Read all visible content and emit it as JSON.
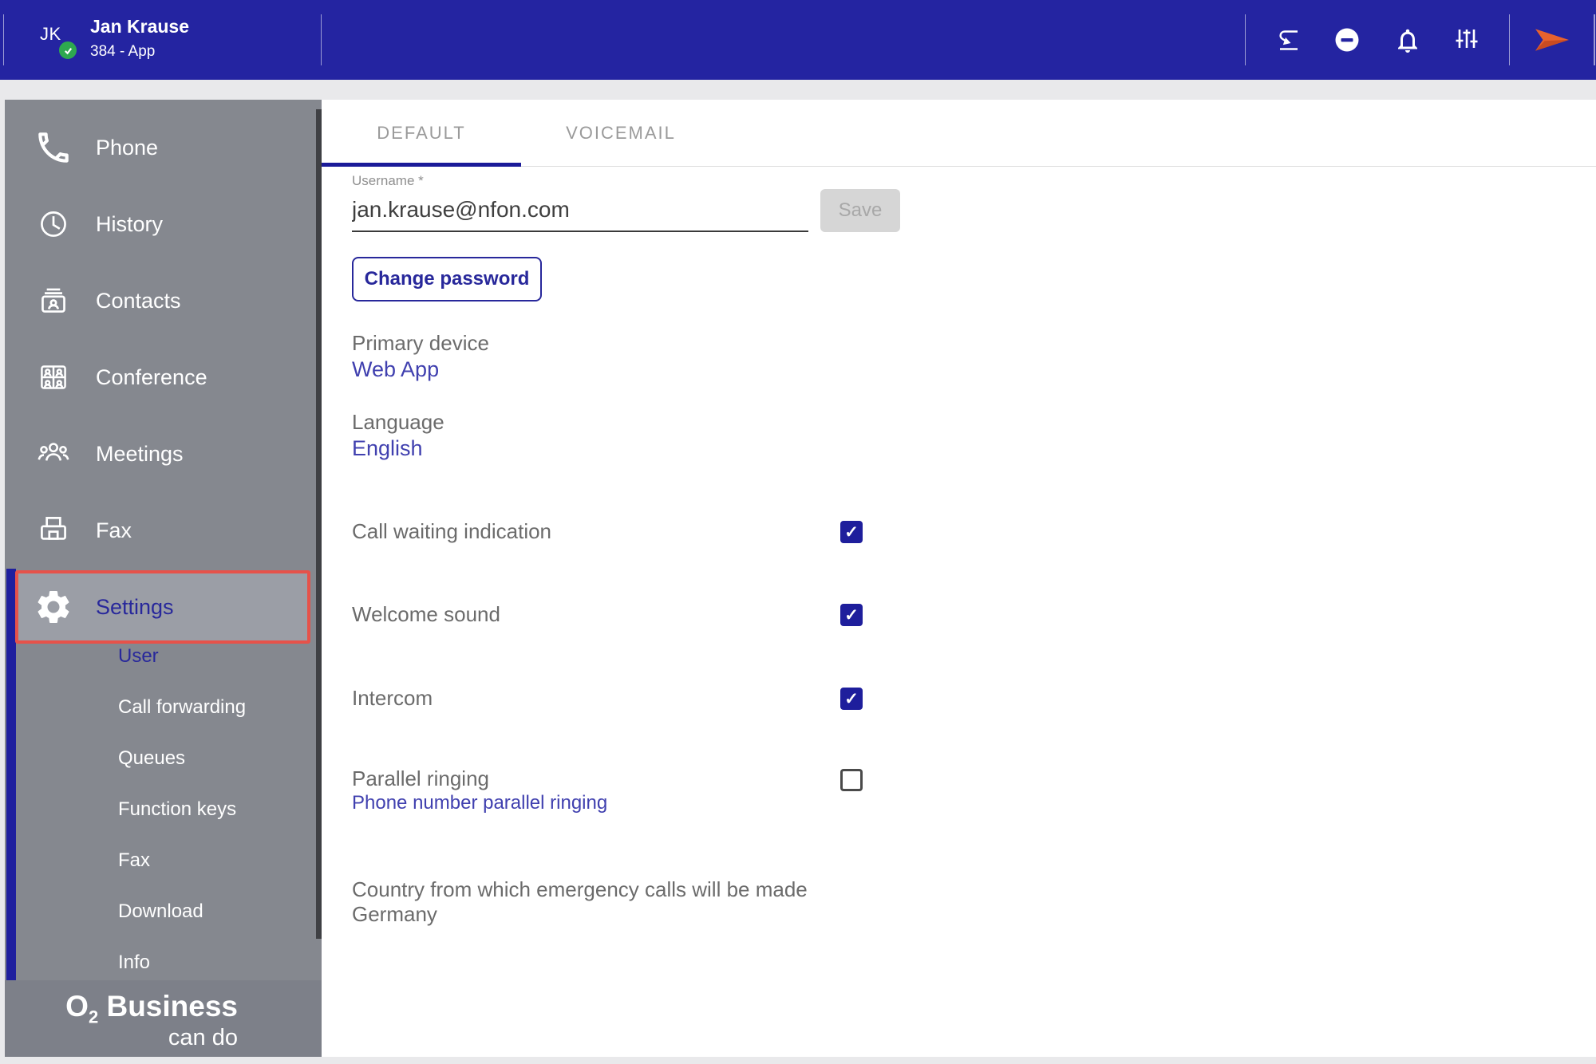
{
  "topbar": {
    "avatar_initials": "JK",
    "status": "online",
    "user_name": "Jan Krause",
    "user_subtitle": "384 - App",
    "icons": [
      "call-pull-icon",
      "dnd-status-icon",
      "notifications-icon",
      "tune-icon",
      "brand-arrow-icon"
    ]
  },
  "sidebar": {
    "items": [
      {
        "label": "Phone",
        "icon": "phone-icon",
        "selected": false
      },
      {
        "label": "History",
        "icon": "history-icon",
        "selected": false
      },
      {
        "label": "Contacts",
        "icon": "contacts-icon",
        "selected": false
      },
      {
        "label": "Conference",
        "icon": "conference-icon",
        "selected": false
      },
      {
        "label": "Meetings",
        "icon": "meetings-icon",
        "selected": false
      },
      {
        "label": "Fax",
        "icon": "fax-icon",
        "selected": false
      },
      {
        "label": "Settings",
        "icon": "settings-gear-icon",
        "selected": true,
        "highlighted_red": true
      }
    ],
    "subitems": [
      {
        "label": "User",
        "selected": true
      },
      {
        "label": "Call forwarding",
        "selected": false
      },
      {
        "label": "Queues",
        "selected": false
      },
      {
        "label": "Function keys",
        "selected": false
      },
      {
        "label": "Fax",
        "selected": false
      },
      {
        "label": "Download",
        "selected": false
      },
      {
        "label": "Info",
        "selected": false
      }
    ],
    "brand": {
      "o": "O",
      "sub": "2",
      "rest": " Business",
      "line2": "can do"
    }
  },
  "main": {
    "tabs": [
      {
        "label": "DEFAULT",
        "active": true
      },
      {
        "label": "VOICEMAIL",
        "active": false
      }
    ],
    "username": {
      "label": "Username *",
      "value": "jan.krause@nfon.com"
    },
    "save_label": "Save",
    "save_disabled": true,
    "change_password_label": "Change password",
    "fields": [
      {
        "label": "Primary device",
        "value": "Web App"
      },
      {
        "label": "Language",
        "value": "English"
      }
    ],
    "toggles": [
      {
        "label": "Call waiting indication",
        "checked": true
      },
      {
        "label": "Welcome sound",
        "checked": true
      },
      {
        "label": "Intercom",
        "checked": true
      },
      {
        "label": "Parallel ringing",
        "link": "Phone number parallel ringing",
        "checked": false
      }
    ],
    "country": {
      "label": "Country from which emergency calls will be made",
      "value": "Germany"
    }
  },
  "colors": {
    "topbar_blue": "#2424A1",
    "accent_indigo": "#28289B",
    "link_indigo": "#4040AF",
    "checkbox_blue": "#1E1E9C",
    "active_tab_underline": "#1B1B99",
    "highlight_red": "#E6524A",
    "brand_orange": "#E8622D",
    "status_green": "#2EA84F",
    "sidebar_gray": "#85888F",
    "footer_gray": "#7D8089"
  }
}
